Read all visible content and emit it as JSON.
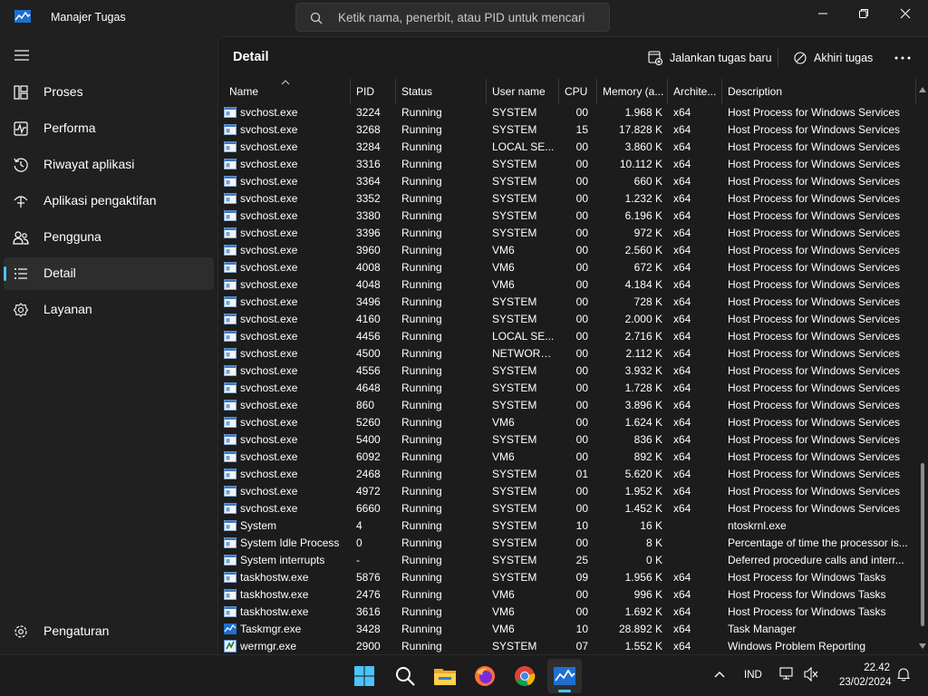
{
  "window": {
    "title": "Manajer Tugas",
    "search_placeholder": "Ketik nama, penerbit, atau PID untuk mencari"
  },
  "sidebar": {
    "items": [
      {
        "label": "Proses",
        "icon": "processes-icon"
      },
      {
        "label": "Performa",
        "icon": "performance-icon"
      },
      {
        "label": "Riwayat aplikasi",
        "icon": "app-history-icon"
      },
      {
        "label": "Aplikasi pengaktifan",
        "icon": "startup-apps-icon"
      },
      {
        "label": "Pengguna",
        "icon": "users-icon"
      },
      {
        "label": "Detail",
        "icon": "details-icon",
        "active": true
      },
      {
        "label": "Layanan",
        "icon": "services-icon"
      }
    ],
    "settings_label": "Pengaturan"
  },
  "main": {
    "title": "Detail",
    "run_new_task_label": "Jalankan tugas baru",
    "end_task_label": "Akhiri tugas"
  },
  "table": {
    "columns": [
      "Name",
      "PID",
      "Status",
      "User name",
      "CPU",
      "Memory (a...",
      "Archite...",
      "Description"
    ],
    "rows": [
      [
        "svchost.exe",
        "3224",
        "Running",
        "SYSTEM",
        "00",
        "1.968 K",
        "x64",
        "Host Process for Windows Services"
      ],
      [
        "svchost.exe",
        "3268",
        "Running",
        "SYSTEM",
        "15",
        "17.828 K",
        "x64",
        "Host Process for Windows Services"
      ],
      [
        "svchost.exe",
        "3284",
        "Running",
        "LOCAL SE...",
        "00",
        "3.860 K",
        "x64",
        "Host Process for Windows Services"
      ],
      [
        "svchost.exe",
        "3316",
        "Running",
        "SYSTEM",
        "00",
        "10.112 K",
        "x64",
        "Host Process for Windows Services"
      ],
      [
        "svchost.exe",
        "3364",
        "Running",
        "SYSTEM",
        "00",
        "660 K",
        "x64",
        "Host Process for Windows Services"
      ],
      [
        "svchost.exe",
        "3352",
        "Running",
        "SYSTEM",
        "00",
        "1.232 K",
        "x64",
        "Host Process for Windows Services"
      ],
      [
        "svchost.exe",
        "3380",
        "Running",
        "SYSTEM",
        "00",
        "6.196 K",
        "x64",
        "Host Process for Windows Services"
      ],
      [
        "svchost.exe",
        "3396",
        "Running",
        "SYSTEM",
        "00",
        "972 K",
        "x64",
        "Host Process for Windows Services"
      ],
      [
        "svchost.exe",
        "3960",
        "Running",
        "VM6",
        "00",
        "2.560 K",
        "x64",
        "Host Process for Windows Services"
      ],
      [
        "svchost.exe",
        "4008",
        "Running",
        "VM6",
        "00",
        "672 K",
        "x64",
        "Host Process for Windows Services"
      ],
      [
        "svchost.exe",
        "4048",
        "Running",
        "VM6",
        "00",
        "4.184 K",
        "x64",
        "Host Process for Windows Services"
      ],
      [
        "svchost.exe",
        "3496",
        "Running",
        "SYSTEM",
        "00",
        "728 K",
        "x64",
        "Host Process for Windows Services"
      ],
      [
        "svchost.exe",
        "4160",
        "Running",
        "SYSTEM",
        "00",
        "2.000 K",
        "x64",
        "Host Process for Windows Services"
      ],
      [
        "svchost.exe",
        "4456",
        "Running",
        "LOCAL SE...",
        "00",
        "2.716 K",
        "x64",
        "Host Process for Windows Services"
      ],
      [
        "svchost.exe",
        "4500",
        "Running",
        "NETWORK...",
        "00",
        "2.112 K",
        "x64",
        "Host Process for Windows Services"
      ],
      [
        "svchost.exe",
        "4556",
        "Running",
        "SYSTEM",
        "00",
        "3.932 K",
        "x64",
        "Host Process for Windows Services"
      ],
      [
        "svchost.exe",
        "4648",
        "Running",
        "SYSTEM",
        "00",
        "1.728 K",
        "x64",
        "Host Process for Windows Services"
      ],
      [
        "svchost.exe",
        "860",
        "Running",
        "SYSTEM",
        "00",
        "3.896 K",
        "x64",
        "Host Process for Windows Services"
      ],
      [
        "svchost.exe",
        "5260",
        "Running",
        "VM6",
        "00",
        "1.624 K",
        "x64",
        "Host Process for Windows Services"
      ],
      [
        "svchost.exe",
        "5400",
        "Running",
        "SYSTEM",
        "00",
        "836 K",
        "x64",
        "Host Process for Windows Services"
      ],
      [
        "svchost.exe",
        "6092",
        "Running",
        "VM6",
        "00",
        "892 K",
        "x64",
        "Host Process for Windows Services"
      ],
      [
        "svchost.exe",
        "2468",
        "Running",
        "SYSTEM",
        "01",
        "5.620 K",
        "x64",
        "Host Process for Windows Services"
      ],
      [
        "svchost.exe",
        "4972",
        "Running",
        "SYSTEM",
        "00",
        "1.952 K",
        "x64",
        "Host Process for Windows Services"
      ],
      [
        "svchost.exe",
        "6660",
        "Running",
        "SYSTEM",
        "00",
        "1.452 K",
        "x64",
        "Host Process for Windows Services"
      ],
      [
        "System",
        "4",
        "Running",
        "SYSTEM",
        "10",
        "16 K",
        "",
        "ntoskrnl.exe"
      ],
      [
        "System Idle Process",
        "0",
        "Running",
        "SYSTEM",
        "00",
        "8 K",
        "",
        "Percentage of time the processor is..."
      ],
      [
        "System interrupts",
        "-",
        "Running",
        "SYSTEM",
        "25",
        "0 K",
        "",
        "Deferred procedure calls and interr..."
      ],
      [
        "taskhostw.exe",
        "5876",
        "Running",
        "SYSTEM",
        "09",
        "1.956 K",
        "x64",
        "Host Process for Windows Tasks"
      ],
      [
        "taskhostw.exe",
        "2476",
        "Running",
        "VM6",
        "00",
        "996 K",
        "x64",
        "Host Process for Windows Tasks"
      ],
      [
        "taskhostw.exe",
        "3616",
        "Running",
        "VM6",
        "00",
        "1.692 K",
        "x64",
        "Host Process for Windows Tasks"
      ],
      [
        "Taskmgr.exe",
        "3428",
        "Running",
        "VM6",
        "10",
        "28.892 K",
        "x64",
        "Task Manager"
      ],
      [
        "wermgr.exe",
        "2900",
        "Running",
        "SYSTEM",
        "07",
        "1.552 K",
        "x64",
        "Windows Problem Reporting"
      ]
    ],
    "row_icons": [
      "svchost-icon",
      "svchost-icon",
      "svchost-icon",
      "svchost-icon",
      "svchost-icon",
      "svchost-icon",
      "svchost-icon",
      "svchost-icon",
      "svchost-icon",
      "svchost-icon",
      "svchost-icon",
      "svchost-icon",
      "svchost-icon",
      "svchost-icon",
      "svchost-icon",
      "svchost-icon",
      "svchost-icon",
      "svchost-icon",
      "svchost-icon",
      "svchost-icon",
      "svchost-icon",
      "svchost-icon",
      "svchost-icon",
      "svchost-icon",
      "system-icon",
      "system-icon",
      "system-icon",
      "taskhostw-icon",
      "taskhostw-icon",
      "taskhostw-icon",
      "task-manager-icon",
      "wermgr-icon"
    ]
  },
  "taskbar": {
    "apps": [
      "start-icon",
      "search-icon",
      "file-explorer-icon",
      "firefox-icon",
      "chrome-icon",
      "task-manager-icon"
    ],
    "language": "IND",
    "time": "22.42",
    "date": "23/02/2024"
  },
  "colors": {
    "accent": "#4cc2ff",
    "background": "#1c1c1c",
    "sidebar": "#202020"
  }
}
